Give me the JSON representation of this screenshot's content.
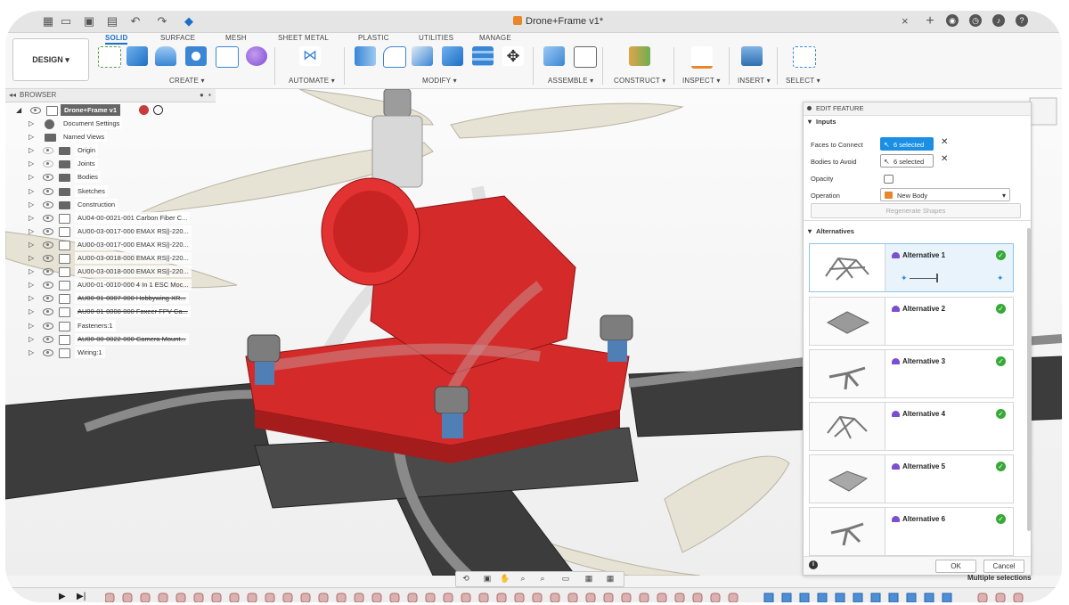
{
  "titlebar": {
    "document_title": "Drone+Frame v1*",
    "close_tab": "×",
    "add_tab": "+"
  },
  "ribbon": {
    "workspace": "DESIGN ▾",
    "tabs": [
      "SOLID",
      "SURFACE",
      "MESH",
      "SHEET METAL",
      "PLASTIC",
      "UTILITIES",
      "MANAGE"
    ],
    "active_tab": "SOLID",
    "groups": [
      "CREATE ▾",
      "AUTOMATE ▾",
      "MODIFY ▾",
      "ASSEMBLE ▾",
      "CONSTRUCT ▾",
      "INSPECT ▾",
      "INSERT ▾",
      "SELECT ▾"
    ]
  },
  "browser": {
    "title": "BROWSER",
    "root": "Drone+Frame v1",
    "items": [
      {
        "label": "Document Settings",
        "icon": "gear-icon"
      },
      {
        "label": "Named Views",
        "icon": "folder-icon"
      },
      {
        "label": "Origin",
        "icon": "folder-icon"
      },
      {
        "label": "Joints",
        "icon": "folder-icon"
      },
      {
        "label": "Bodies",
        "icon": "folder-icon"
      },
      {
        "label": "Sketches",
        "icon": "folder-icon"
      },
      {
        "label": "Construction",
        "icon": "folder-icon"
      },
      {
        "label": "AU04-00-0021-001 Carbon Fiber C...",
        "icon": "component-icon"
      },
      {
        "label": "AU00-03-0017-000 EMAX RS||-220...",
        "icon": "component-icon"
      },
      {
        "label": "AU00-03-0017-000 EMAX RS||-220...",
        "icon": "component-icon"
      },
      {
        "label": "AU00-03-0018-000 EMAX RS||-220...",
        "icon": "component-icon"
      },
      {
        "label": "AU00-03-0018-000 EMAX RS||-220...",
        "icon": "component-icon"
      },
      {
        "label": "AU00-01-0010-000 4 In 1 ESC Moc...",
        "icon": "component-icon"
      },
      {
        "label": "AU00-01-0007-000 Hobbywing XR...",
        "icon": "component-icon"
      },
      {
        "label": "AU00-01-0008-000 Foxeer FPV Ca...",
        "icon": "component-icon"
      },
      {
        "label": "Fasteners:1",
        "icon": "component-icon"
      },
      {
        "label": "AU00-00-0022-000 Camera Mount...",
        "icon": "component-icon"
      },
      {
        "label": "Wiring:1",
        "icon": "component-icon"
      }
    ]
  },
  "edit_feature": {
    "title": "EDIT FEATURE",
    "inputs_section": "Inputs",
    "faces_label": "Faces to Connect",
    "faces_value": "6 selected",
    "bodies_label": "Bodies to Avoid",
    "bodies_value": "6 selected",
    "opacity_label": "Opacity",
    "operation_label": "Operation",
    "operation_value": "New Body",
    "regenerate": "Regenerate Shapes",
    "alternatives_section": "Alternatives",
    "alternatives": [
      "Alternative 1",
      "Alternative 2",
      "Alternative 3",
      "Alternative 4",
      "Alternative 5",
      "Alternative 6"
    ],
    "ok": "OK",
    "cancel": "Cancel",
    "info": "i"
  },
  "status": {
    "message": "Multiple selections"
  },
  "colors": {
    "accent": "#1a8fe3",
    "selected_part": "#d42a2a",
    "check_green": "#36a936"
  }
}
